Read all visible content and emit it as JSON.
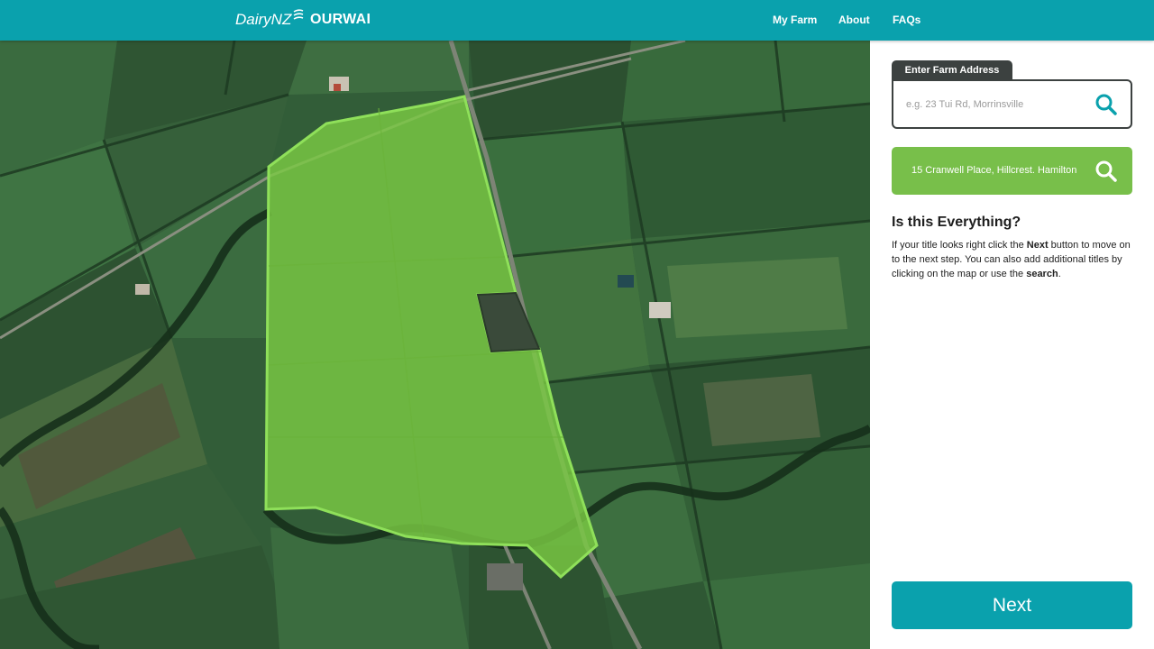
{
  "header": {
    "brand": "DairyNZ",
    "product": "OURWAI",
    "nav": [
      {
        "label": "My Farm"
      },
      {
        "label": "About"
      },
      {
        "label": "FAQs"
      }
    ],
    "background_color": "#0aa1ad"
  },
  "panel": {
    "address_tab_label": "Enter Farm Address",
    "address_placeholder": "e.g. 23 Tui Rd, Morrinsville",
    "address_value": "",
    "search_icon": "search-icon",
    "result_address": "15 Cranwell Place, Hillcrest. Hamilton",
    "result_color": "#78bf4a",
    "question_title": "Is this Everything?",
    "description": {
      "t1": "If your title looks right click the ",
      "b1": "Next",
      "t2": " button to move on to the next step. You can also add additional titles by clicking on the map or use the ",
      "b2": "search",
      "t3": "."
    },
    "next_label": "Next"
  },
  "map": {
    "type": "satellite",
    "highlight_color": "#7ac943"
  }
}
